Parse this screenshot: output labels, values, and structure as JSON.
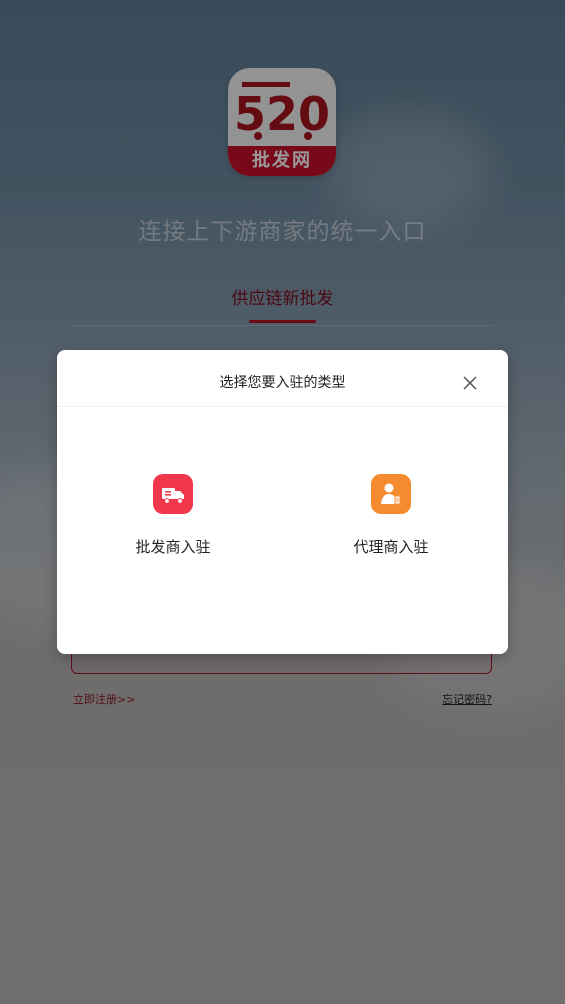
{
  "logo": {
    "badge_text": "批发网",
    "mark_text": "520"
  },
  "login": {
    "slogan": "连接上下游商家的统一入口",
    "tab_label": "供应链新批发",
    "register_link": "立即注册>>",
    "forgot_link": "忘记密码?"
  },
  "modal": {
    "title": "选择您要入驻的类型",
    "options": [
      {
        "label": "批发商入驻",
        "icon": "wholesale-truck-icon",
        "color": "#f1384b"
      },
      {
        "label": "代理商入驻",
        "icon": "agent-person-icon",
        "color": "#f68a2f"
      }
    ]
  },
  "colors": {
    "brand": "#c8102e",
    "accent": "#b01024"
  }
}
